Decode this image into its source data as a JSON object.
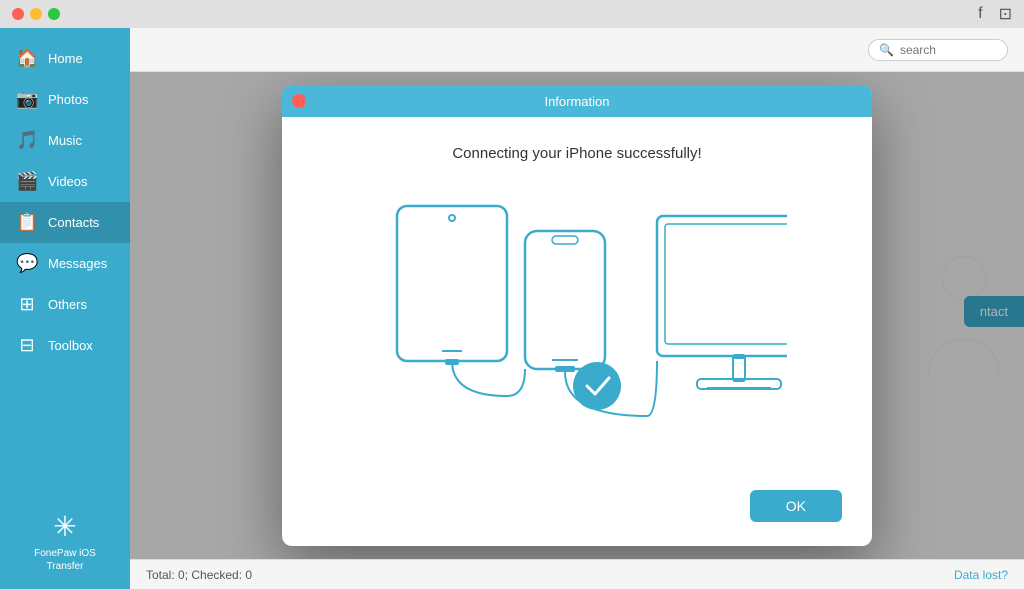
{
  "titlebar": {
    "app_name": "FonePaw iOS Transfer"
  },
  "sidebar": {
    "items": [
      {
        "id": "home",
        "label": "Home",
        "icon": "🏠"
      },
      {
        "id": "photos",
        "label": "Photos",
        "icon": "📷"
      },
      {
        "id": "music",
        "label": "Music",
        "icon": "🎵"
      },
      {
        "id": "videos",
        "label": "Videos",
        "icon": "🎬"
      },
      {
        "id": "contacts",
        "label": "Contacts",
        "icon": "📋"
      },
      {
        "id": "messages",
        "label": "Messages",
        "icon": "💬"
      },
      {
        "id": "others",
        "label": "Others",
        "icon": "⊞"
      },
      {
        "id": "toolbox",
        "label": "Toolbox",
        "icon": "⊟"
      }
    ],
    "active": "contacts",
    "app_label": "FonePaw iOS Transfer"
  },
  "topbar": {
    "search_placeholder": "search",
    "facebook_icon": "f",
    "message_icon": "✉"
  },
  "modal": {
    "title": "Information",
    "message": "Connecting your iPhone successfully!",
    "ok_label": "OK"
  },
  "bottombar": {
    "status": "Total: 0; Checked: 0",
    "data_lost_link": "Data lost?"
  },
  "contact_btn": "ntact"
}
